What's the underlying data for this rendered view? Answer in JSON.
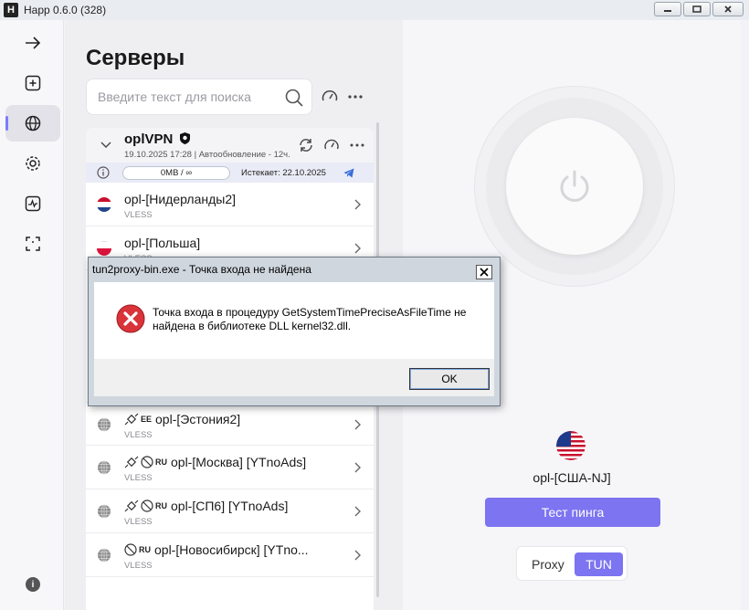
{
  "window": {
    "title": "Happ 0.6.0 (328)",
    "logo": "H"
  },
  "sidebar": {
    "items": [
      {
        "name": "arrow-right-icon"
      },
      {
        "name": "plus-square-icon"
      },
      {
        "name": "globe-icon",
        "active": true
      },
      {
        "name": "gear-icon"
      },
      {
        "name": "activity-chart-icon"
      },
      {
        "name": "scan-bracket-icon"
      }
    ],
    "info_label": "i"
  },
  "servers": {
    "title": "Серверы",
    "search_placeholder": "Введите текст для поиска",
    "group": {
      "name": "oplVPN",
      "updated": "19.10.2025 17:28 | Автообновление - 12ч.",
      "usage": "0MB / ∞",
      "expires": "Истекает: 22.10.2025"
    },
    "rows_top": [
      {
        "name": "opl-[Нидерланды2]",
        "protocol": "VLESS",
        "flag": "nl"
      },
      {
        "name": "opl-[Польша]",
        "protocol": "VLESS",
        "flag": "pl"
      }
    ],
    "rows_bottom": [
      {
        "emoji": "satellite",
        "cc": "EE",
        "name": "opl-[Эстония2]",
        "protocol": "VLESS"
      },
      {
        "emoji": "satellite-noads",
        "cc": "RU",
        "name": "opl-[Москва] [YTnoAds]",
        "protocol": "VLESS"
      },
      {
        "emoji": "satellite-noads",
        "cc": "RU",
        "name": "opl-[СП6] [YTnoAds]",
        "protocol": "VLESS"
      },
      {
        "emoji": "noads",
        "cc": "RU",
        "name": "opl-[Новосибирск] [YTno...",
        "protocol": "VLESS"
      }
    ]
  },
  "connection": {
    "current_server": "opl-[США-NJ]",
    "ping_button": "Тест пинга",
    "mode_proxy": "Proxy",
    "mode_tun": "TUN",
    "accent": "#7c74f0"
  },
  "dialog": {
    "title": "tun2proxy-bin.exe - Точка входа не найдена",
    "message": "Точка входа в процедуру GetSystemTimePreciseAsFileTime не найдена в библиотеке DLL kernel32.dll.",
    "ok_label": "OK"
  }
}
